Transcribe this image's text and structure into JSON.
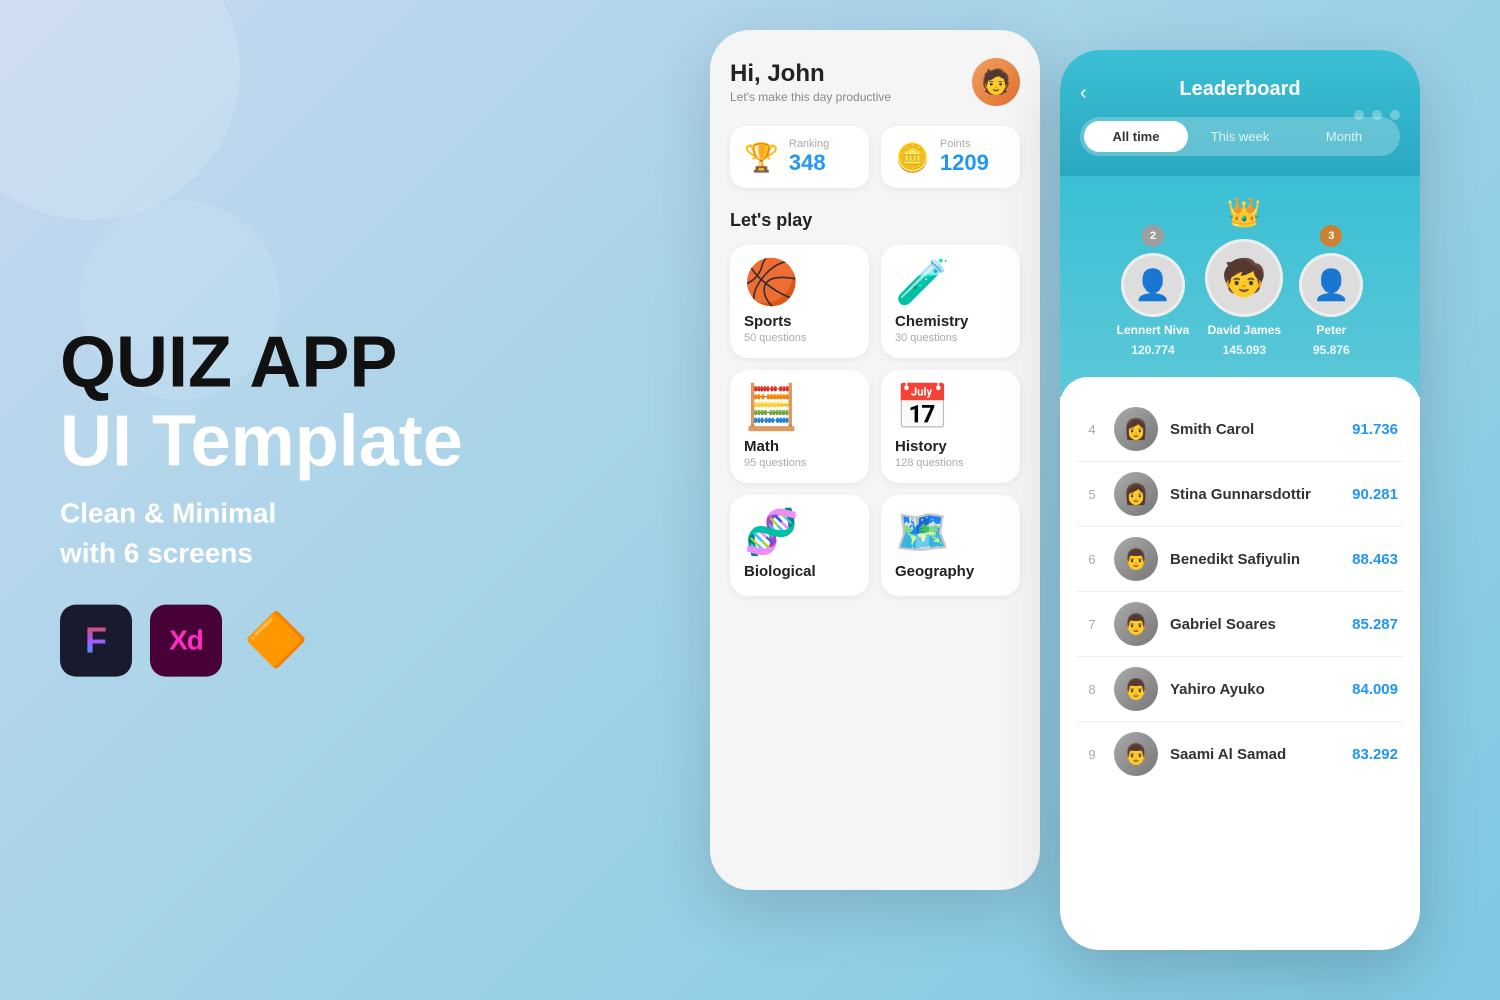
{
  "background": {
    "gradient_start": "#c8d8f0",
    "gradient_end": "#7ec8e3"
  },
  "left": {
    "title_line1": "QUIZ APP",
    "title_line2": "UI Template",
    "subtitle_line1": "Clean & Minimal",
    "subtitle_line2": "with 6 screens",
    "tools": [
      {
        "name": "Figma",
        "label": "F"
      },
      {
        "name": "Adobe XD",
        "label": "Xd"
      },
      {
        "name": "Sketch",
        "label": "◆"
      }
    ]
  },
  "phone1": {
    "greeting": "Hi, John",
    "greeting_sub": "Let's make this day productive",
    "stats": [
      {
        "label": "Ranking",
        "value": "348",
        "icon": "🏆"
      },
      {
        "label": "Points",
        "value": "1209",
        "icon": "🪙"
      }
    ],
    "section_title": "Let's play",
    "categories": [
      {
        "name": "Sports",
        "questions": "50 questions",
        "emoji": "🏀"
      },
      {
        "name": "Chemistry",
        "questions": "30 questions",
        "emoji": "🧪"
      },
      {
        "name": "Math",
        "questions": "95 questions",
        "emoji": "🧮"
      },
      {
        "name": "History",
        "questions": "128 questions",
        "emoji": "📅"
      },
      {
        "name": "Biological",
        "questions": "",
        "emoji": "🧬"
      },
      {
        "name": "Geography",
        "questions": "",
        "emoji": "🗺️"
      }
    ]
  },
  "phone2": {
    "title": "Leaderboard",
    "back_icon": "‹",
    "filters": [
      "All time",
      "This week",
      "Month"
    ],
    "active_filter": 0,
    "podium": [
      {
        "rank": 2,
        "name": "Lennert Niva",
        "score": "120.774",
        "emoji": "👤"
      },
      {
        "rank": 1,
        "name": "David James",
        "score": "145.093",
        "emoji": "🧒",
        "crown": "👑"
      },
      {
        "rank": 3,
        "name": "Peter",
        "score": "95.876",
        "emoji": "👤"
      }
    ],
    "list": [
      {
        "rank": 4,
        "name": "Smith Carol",
        "score": "91.736"
      },
      {
        "rank": 5,
        "name": "Stina Gunnarsdottir",
        "score": "90.281"
      },
      {
        "rank": 6,
        "name": "Benedikt Safiyulin",
        "score": "88.463"
      },
      {
        "rank": 7,
        "name": "Gabriel Soares",
        "score": "85.287"
      },
      {
        "rank": 8,
        "name": "Yahiro Ayuko",
        "score": "84.009"
      },
      {
        "rank": 9,
        "name": "Saami Al Samad",
        "score": "83.292"
      }
    ]
  }
}
